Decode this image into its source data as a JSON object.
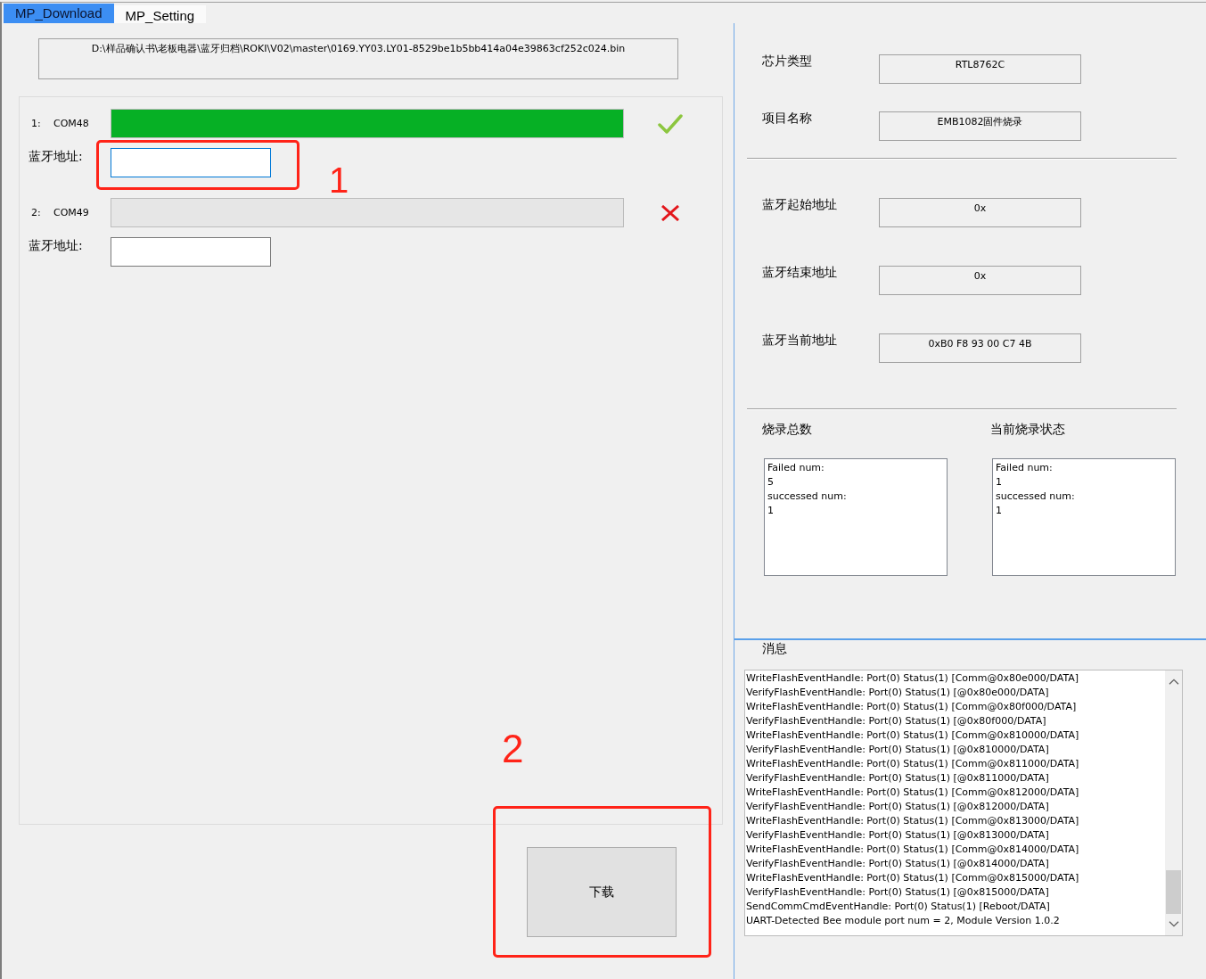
{
  "tabs": [
    {
      "label": "MP_Download",
      "selected": true
    },
    {
      "label": "MP_Setting",
      "selected": false
    }
  ],
  "file_path": "D:\\样品确认书\\老板电器\\蓝牙归档\\ROKI\\V02\\master\\0169.YY03.LY01-8529be1b5bb414a04e39863cf252c024.bin",
  "ports": [
    {
      "number": "1:",
      "name": "COM48",
      "level": 1,
      "passed": true,
      "address_label": "蓝牙地址:",
      "address_focused": true,
      "address_annotation": "1"
    },
    {
      "number": "2:",
      "name": "COM49",
      "level": 0,
      "passed": false,
      "address_label": "蓝牙地址:",
      "address_focused": false
    }
  ],
  "download_button": {
    "label": "下载",
    "annotation": "2"
  },
  "info_groups": [
    {
      "fields": [
        {
          "label": "芯片类型",
          "value": "RTL8762C"
        },
        {
          "label": "项目名称",
          "value": "EMB1082固件烧录"
        }
      ]
    },
    {
      "fields": [
        {
          "label": "蓝牙起始地址",
          "value": "0x"
        },
        {
          "label": "蓝牙结束地址",
          "value": "0x"
        },
        {
          "label": "蓝牙当前地址",
          "value": "0xB0 F8 93 00 C7 4B"
        }
      ]
    }
  ],
  "counters": [
    {
      "title": "烧录总数",
      "lines": [
        "Failed num:",
        "5",
        "successed num:",
        "1"
      ]
    },
    {
      "title": "当前烧录状态",
      "lines": [
        "Failed num:",
        "1",
        "successed num:",
        "1"
      ]
    }
  ],
  "messages": {
    "title": "消息",
    "lines": [
      "WriteFlashEventHandle: Port(0) Status(1) [Comm@0x80e000/DATA]",
      "VerifyFlashEventHandle: Port(0) Status(1) [@0x80e000/DATA]",
      "WriteFlashEventHandle: Port(0) Status(1) [Comm@0x80f000/DATA]",
      "VerifyFlashEventHandle: Port(0) Status(1) [@0x80f000/DATA]",
      "WriteFlashEventHandle: Port(0) Status(1) [Comm@0x810000/DATA]",
      "VerifyFlashEventHandle: Port(0) Status(1) [@0x810000/DATA]",
      "WriteFlashEventHandle: Port(0) Status(1) [Comm@0x811000/DATA]",
      "VerifyFlashEventHandle: Port(0) Status(1) [@0x811000/DATA]",
      "WriteFlashEventHandle: Port(0) Status(1) [Comm@0x812000/DATA]",
      "VerifyFlashEventHandle: Port(0) Status(1) [@0x812000/DATA]",
      "WriteFlashEventHandle: Port(0) Status(1) [Comm@0x813000/DATA]",
      "VerifyFlashEventHandle: Port(0) Status(1) [@0x813000/DATA]",
      "WriteFlashEventHandle: Port(0) Status(1) [Comm@0x814000/DATA]",
      "VerifyFlashEventHandle: Port(0) Status(1) [@0x814000/DATA]",
      "WriteFlashEventHandle: Port(0) Status(1) [Comm@0x815000/DATA]",
      "VerifyFlashEventHandle: Port(0) Status(1) [@0x815000/DATA]",
      "SendCommCmdEventHandle: Port(0) Status(1) [Reboot/DATA]",
      "UART-Detected Bee module port num = 2, Module Version 1.0.2"
    ]
  }
}
